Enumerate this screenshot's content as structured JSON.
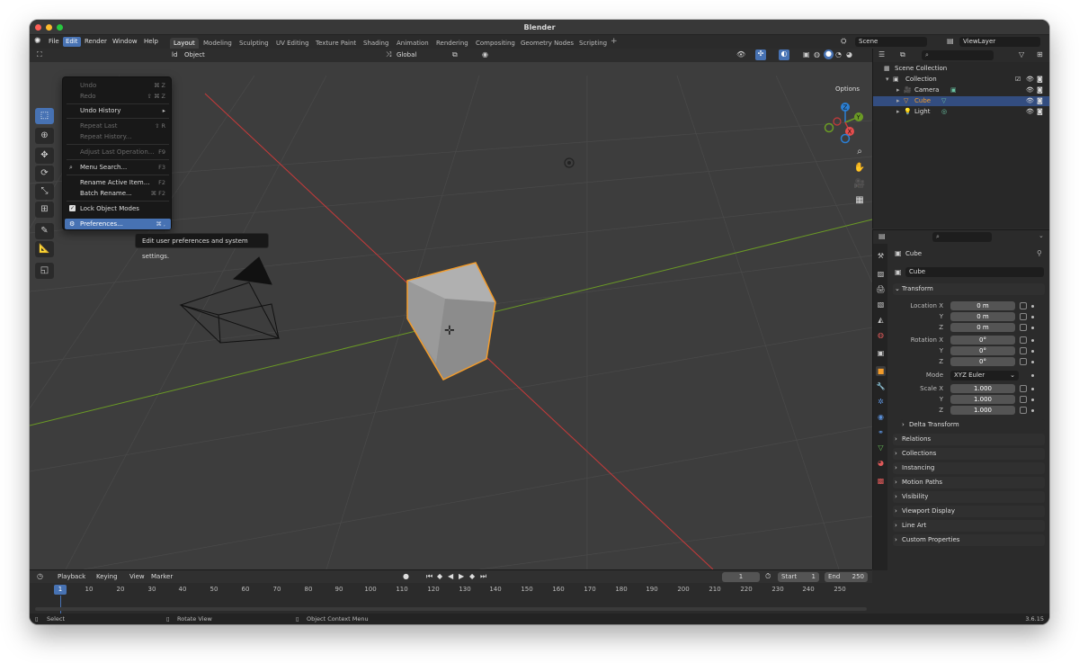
{
  "window": {
    "title": "Blender"
  },
  "menus": [
    "File",
    "Edit",
    "Render",
    "Window",
    "Help"
  ],
  "workspaces": [
    "Layout",
    "Modeling",
    "Sculpting",
    "UV Editing",
    "Texture Paint",
    "Shading",
    "Animation",
    "Rendering",
    "Compositing",
    "Geometry Nodes",
    "Scripting"
  ],
  "scene": {
    "name": "Scene",
    "view_layer": "ViewLayer"
  },
  "viewport": {
    "header_add": "ld",
    "header_object": "Object",
    "orientation": "Global",
    "options": "Options"
  },
  "edit_menu": {
    "undo": "Undo",
    "undo_sc": "⌘ Z",
    "redo": "Redo",
    "redo_sc": "⇧ ⌘ Z",
    "undo_history": "Undo History",
    "repeat_last": "Repeat Last",
    "repeat_last_sc": "⇧ R",
    "repeat_history": "Repeat History...",
    "adjust_last": "Adjust Last Operation...",
    "adjust_last_sc": "F9",
    "menu_search": "Menu Search...",
    "menu_search_sc": "F3",
    "rename_active": "Rename Active Item...",
    "rename_active_sc": "F2",
    "batch_rename": "Batch Rename...",
    "batch_rename_sc": "⌘ F2",
    "lock_object_modes": "Lock Object Modes",
    "preferences": "Preferences...",
    "preferences_sc": "⌘ ,"
  },
  "tooltip": "Edit user preferences and system settings.",
  "outliner": {
    "scene_collection": "Scene Collection",
    "collection": "Collection",
    "items": [
      "Camera",
      "Cube",
      "Light"
    ]
  },
  "properties": {
    "object_name": "Cube",
    "data_name": "Cube",
    "transform_label": "Transform",
    "location_label": "Location X",
    "rotation_label": "Rotation X",
    "scale_label": "Scale X",
    "axis_y": "Y",
    "axis_z": "Z",
    "location": [
      "0 m",
      "0 m",
      "0 m"
    ],
    "rotation": [
      "0°",
      "0°",
      "0°"
    ],
    "mode_label": "Mode",
    "mode": "XYZ Euler",
    "scale": [
      "1.000",
      "1.000",
      "1.000"
    ],
    "delta_transform": "Delta Transform",
    "panels": [
      "Relations",
      "Collections",
      "Instancing",
      "Motion Paths",
      "Visibility",
      "Viewport Display",
      "Line Art",
      "Custom Properties"
    ]
  },
  "timeline": {
    "menus": [
      "Playback",
      "Keying",
      "View",
      "Marker"
    ],
    "current_frame": "1",
    "start_label": "Start",
    "start": "1",
    "end_label": "End",
    "end": "250",
    "ticks": [
      "10",
      "20",
      "30",
      "40",
      "50",
      "60",
      "70",
      "80",
      "90",
      "100",
      "110",
      "120",
      "130",
      "140",
      "150",
      "160",
      "170",
      "180",
      "190",
      "200",
      "210",
      "220",
      "230",
      "240",
      "250"
    ],
    "cursor": "1"
  },
  "statusbar": {
    "select": "Select",
    "rotate": "Rotate View",
    "context": "Object Context Menu",
    "version": "3.6.15"
  },
  "colors": {
    "accent": "#4772b3",
    "selection_orange": "#f39c2b",
    "x_axis": "#c93a3a",
    "y_axis": "#6b9b25"
  }
}
